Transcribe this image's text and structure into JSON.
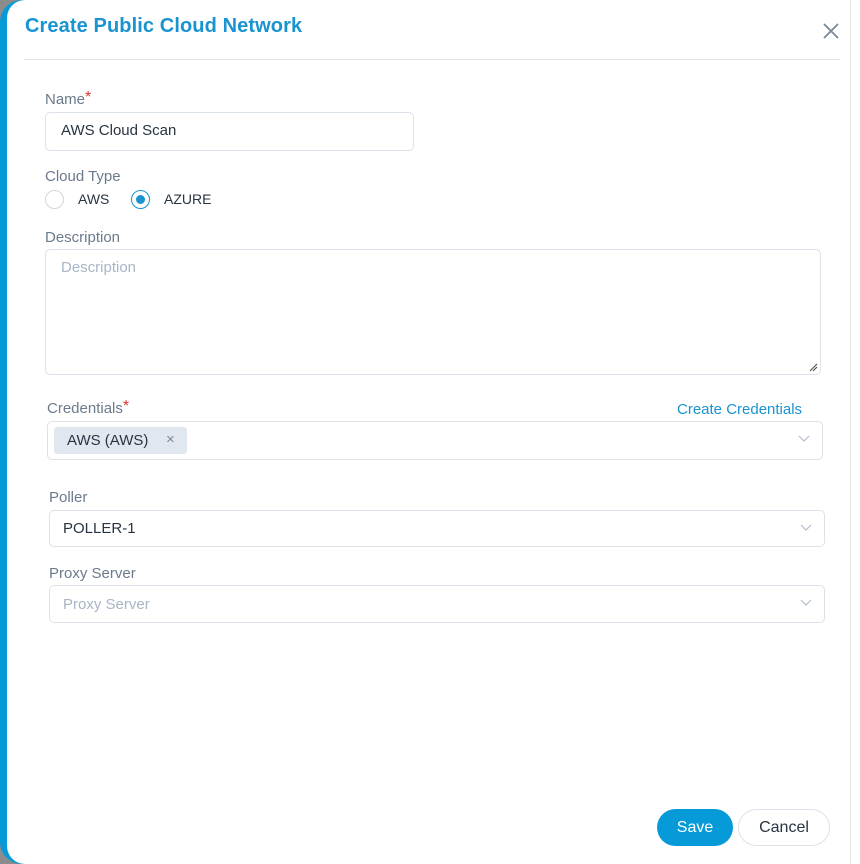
{
  "dialog": {
    "title": "Create Public Cloud Network",
    "close_icon": "close-icon"
  },
  "form": {
    "name": {
      "label": "Name",
      "required_marker": "*",
      "value": "AWS Cloud Scan"
    },
    "cloud_type": {
      "label": "Cloud Type",
      "options": [
        {
          "label": "AWS",
          "checked": false
        },
        {
          "label": "AZURE",
          "checked": true
        }
      ]
    },
    "description": {
      "label": "Description",
      "placeholder": "Description",
      "value": ""
    },
    "credentials": {
      "label": "Credentials",
      "required_marker": "*",
      "create_link": "Create Credentials",
      "selected_tags": [
        {
          "label": "AWS (AWS)",
          "remove_icon": "×"
        }
      ]
    },
    "poller": {
      "label": "Poller",
      "value": "POLLER-1"
    },
    "proxy_server": {
      "label": "Proxy Server",
      "placeholder": "Proxy Server",
      "value": ""
    }
  },
  "footer": {
    "save_label": "Save",
    "cancel_label": "Cancel"
  },
  "colors": {
    "accent": "#079ad9",
    "title": "#1a93d1",
    "required": "#d9342b"
  }
}
